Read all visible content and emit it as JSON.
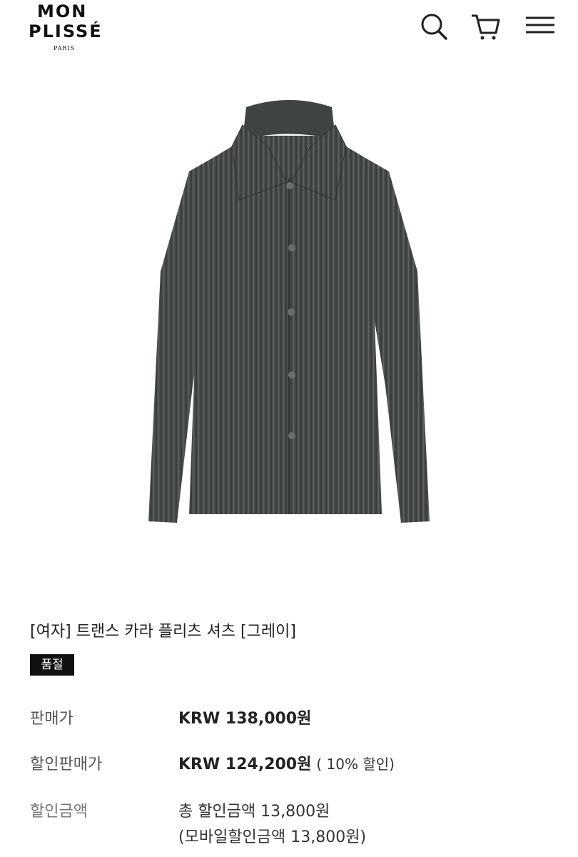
{
  "brand": {
    "line1": "MON",
    "line2": "PLISSÉ",
    "sub": "PARIS"
  },
  "header_icons": [
    "search-icon",
    "cart-icon",
    "menu-icon"
  ],
  "product": {
    "title": "[여자] 트랜스 카라 플리츠 셔츠 [그레이]",
    "badge": "품절",
    "color": "#4a4e4d"
  },
  "pricing": {
    "sale_price_label": "판매가",
    "sale_price_value": "KRW 138,000원",
    "discount_price_label": "할인판매가",
    "discount_price_value": "KRW 124,200원",
    "discount_note": "( 10% 할인)",
    "discount_amount_label": "할인금액",
    "discount_amount_total": "총 할인금액 13,800원",
    "discount_amount_mobile": "(모바일할인금액 13,800원)"
  }
}
